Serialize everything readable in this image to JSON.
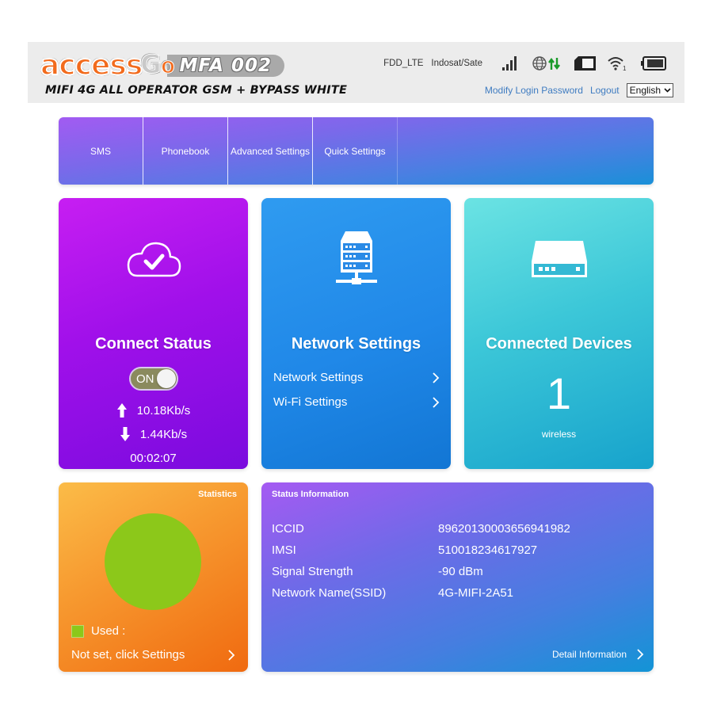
{
  "header": {
    "logo": {
      "brand_part1": "access",
      "brand_part2": "G",
      "brand_part3": "O",
      "model": "MFA 002",
      "tagline": "MIFI 4G ALL OPERATOR GSM + BYPASS WHITE"
    },
    "status": {
      "network_type": "FDD_LTE",
      "operator": "Indosat/Sate",
      "wifi_clients": "1",
      "icons": [
        "signal-strength-icon",
        "globe-icon",
        "data-transfer-icon",
        "sim-card-icon",
        "wifi-icon",
        "battery-icon"
      ],
      "transfer_color": "#1a9a2a"
    },
    "links": {
      "modify_password": "Modify Login Password",
      "logout": "Logout"
    },
    "language": {
      "selected": "English"
    }
  },
  "nav": {
    "items": [
      {
        "label": "SMS"
      },
      {
        "label": "Phonebook"
      },
      {
        "label": "Advanced Settings"
      },
      {
        "label": "Quick Settings"
      }
    ]
  },
  "connect_status": {
    "title": "Connect Status",
    "toggle_label": "ON",
    "toggle_on": true,
    "upload_rate": "10.18Kb/s",
    "download_rate": "1.44Kb/s",
    "connected_time": "00:02:07",
    "icon": "cloud-check-icon"
  },
  "network_settings": {
    "title": "Network Settings",
    "icon": "server-network-icon",
    "links": [
      {
        "label": "Network Settings"
      },
      {
        "label": "Wi-Fi Settings"
      }
    ]
  },
  "connected_devices": {
    "title": "Connected Devices",
    "icon": "router-icon",
    "count": "1",
    "subtitle": "wireless"
  },
  "statistics": {
    "title": "Statistics",
    "legend_label": "Used :",
    "used_color": "#8cc81a",
    "used_fraction": 1.0,
    "settings_link": "Not set, click Settings"
  },
  "status_information": {
    "title": "Status Information",
    "rows": [
      {
        "label": "ICCID",
        "value": "89620130003656941982"
      },
      {
        "label": "IMSI",
        "value": "510018234617927"
      },
      {
        "label": "Signal Strength",
        "value": "-90 dBm"
      },
      {
        "label": "Network Name(SSID)",
        "value": "4G-MIFI-2A51"
      }
    ],
    "detail_link": "Detail Information"
  },
  "colors": {
    "brand_orange": "#f26b1d",
    "link_blue": "#3f7cc1",
    "connect_card": "#a010ea",
    "network_card": "#2088e8",
    "devices_card": "#3cc7d8",
    "stats_card": "#f79a30",
    "status_card": "#6f6ae8"
  }
}
